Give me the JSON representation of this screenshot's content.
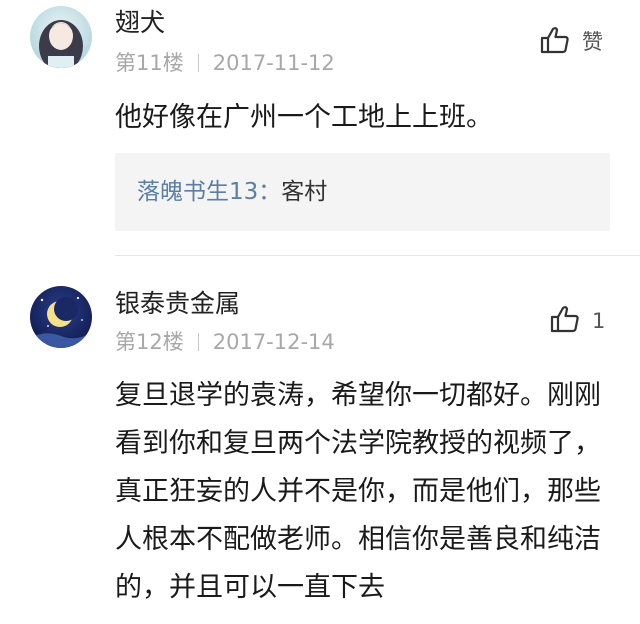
{
  "comments": [
    {
      "username": "翅犬",
      "floor": "第11楼",
      "date": "2017-11-12",
      "like_label": "赞",
      "text": "他好像在广州一个工地上上班。",
      "reply": {
        "name": "落魄书生13：",
        "text": "客村"
      }
    },
    {
      "username": "银泰贵金属",
      "floor": "第12楼",
      "date": "2017-12-14",
      "like_count": "1",
      "text": "复旦退学的袁涛，希望你一切都好。刚刚看到你和复旦两个法学院教授的视频了，真正狂妄的人并不是你，而是他们，那些人根本不配做老师。相信你是善良和纯洁的，并且可以一直下去"
    }
  ],
  "colors": {
    "reply_name": "#5b7ea6",
    "meta": "#a8a8a8",
    "reply_bg": "#f4f4f4"
  }
}
